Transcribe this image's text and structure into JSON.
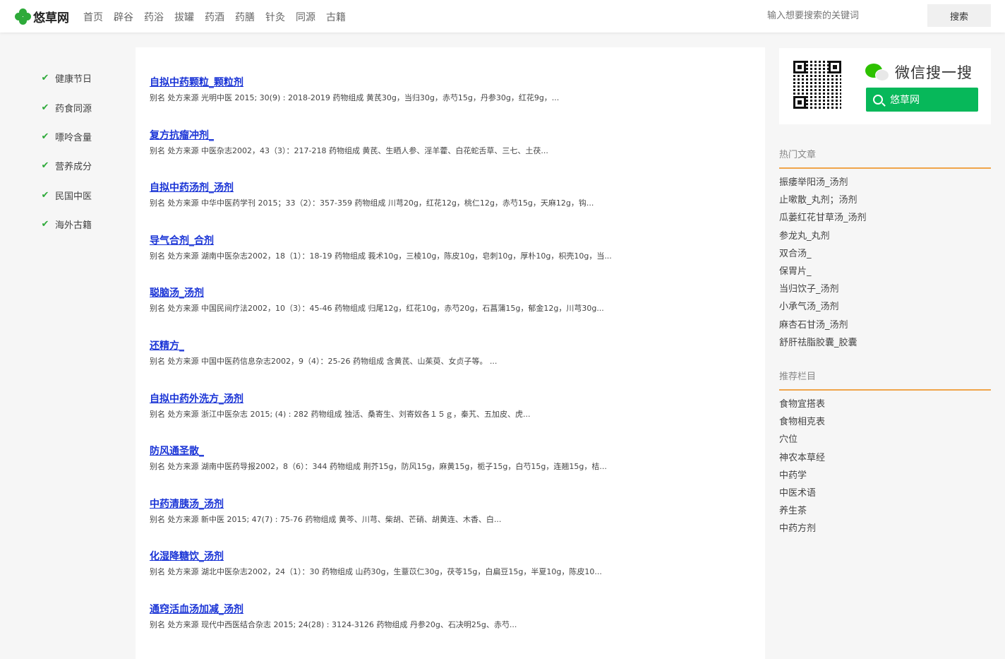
{
  "header": {
    "logo_text": "悠草网",
    "nav": [
      "首页",
      "辟谷",
      "药浴",
      "拔罐",
      "药酒",
      "药膳",
      "针灸",
      "同源",
      "古籍"
    ],
    "search_placeholder": "输入想要搜索的关键词",
    "search_button": "搜索"
  },
  "leftnav": [
    "健康节日",
    "药食同源",
    "嘌呤含量",
    "营养成分",
    "民国中医",
    "海外古籍"
  ],
  "entries": [
    {
      "title": "自拟中药颗粒_颗粒剂",
      "desc": "别名 处方来源 光明中医 2015; 30(9) : 2018-2019 药物组成 黄芪30g，当归30g，赤芍15g，丹参30g，红花9g，..."
    },
    {
      "title": "复方抗瘤冲剂_",
      "desc": "别名 处方来源 中医杂志2002，43（3）：217-218 药物组成 黄芪、生晒人参、淫羊藿、白花蛇舌草、三七、土茯..."
    },
    {
      "title": "自拟中药汤剂_汤剂",
      "desc": "别名 处方来源 中华中医药学刊 2015；33（2）：357-359 药物组成 川芎20g，红花12g，桃仁12g，赤芍15g，天麻12g，钩..."
    },
    {
      "title": "导气合剂_合剂",
      "desc": "别名 处方来源 湖南中医杂志2002，18（1）：18-19 药物组成 莪术10g，三棱10g，陈皮10g，皂刺10g，厚朴10g，枳壳10g，当..."
    },
    {
      "title": "聪脑汤_汤剂",
      "desc": "别名 处方来源 中国民间疗法2002，10（3）：45-46 药物组成 归尾12g，红花10g，赤芍20g，石菖蒲15g，郁金12g，川芎30g..."
    },
    {
      "title": "还精方_",
      "desc": "别名 处方来源 中国中医药信息杂志2002，9（4）：25-26 药物组成 含黄芪、山茱萸、女贞子等。 ..."
    },
    {
      "title": "自拟中药外洗方_汤剂",
      "desc": "别名 处方来源 浙江中医杂志 2015; (4) : 282 药物组成 独活、桑寄生、刘寄奴各１５ｇ，秦艽、五加皮、虎..."
    },
    {
      "title": "防风通圣散_",
      "desc": "别名 处方来源 湖南中医药导报2002，8（6）：344 药物组成 荆芥15g，防风15g，麻黄15g，栀子15g，白芍15g，连翘15g，桔..."
    },
    {
      "title": "中药清胰汤_汤剂",
      "desc": "别名 处方来源 新中医 2015; 47(7) : 75-76 药物组成 黄芩、川芎、柴胡、芒硝、胡黄连、木香、白..."
    },
    {
      "title": "化湿降糖饮_汤剂",
      "desc": "别名 处方来源 湖北中医杂志2002，24（1）：30 药物组成 山药30g，生薏苡仁30g，茯苓15g，白扁豆15g，半夏10g，陈皮10..."
    },
    {
      "title": "通窍活血汤加减_汤剂",
      "desc": "别名 处方来源 现代中西医结合杂志 2015; 24(28) : 3124-3126 药物组成 丹参20g、石决明25g、赤芍..."
    }
  ],
  "weixin": {
    "title": "微信搜一搜",
    "button": "悠草网"
  },
  "hot": {
    "title": "热门文章",
    "items": [
      "振痿举阳汤_汤剂",
      "止嗽散_丸剂；汤剂",
      "瓜蒌红花甘草汤_汤剂",
      "参龙丸_丸剂",
      "双合汤_",
      "保胃片_",
      "当归饮子_汤剂",
      "小承气汤_汤剂",
      "麻杏石甘汤_汤剂",
      "舒肝祛脂胶囊_胶囊"
    ]
  },
  "recommend": {
    "title": "推荐栏目",
    "items": [
      "食物宜搭表",
      "食物相克表",
      "穴位",
      "神农本草经",
      "中药学",
      "中医术语",
      "养生茶",
      "中药方剂"
    ]
  },
  "colors": {
    "accent_green": "#2eaa3a",
    "link_blue": "#1a34d6",
    "orange_rule": "#f0a54a",
    "wechat_green": "#07b85a"
  }
}
